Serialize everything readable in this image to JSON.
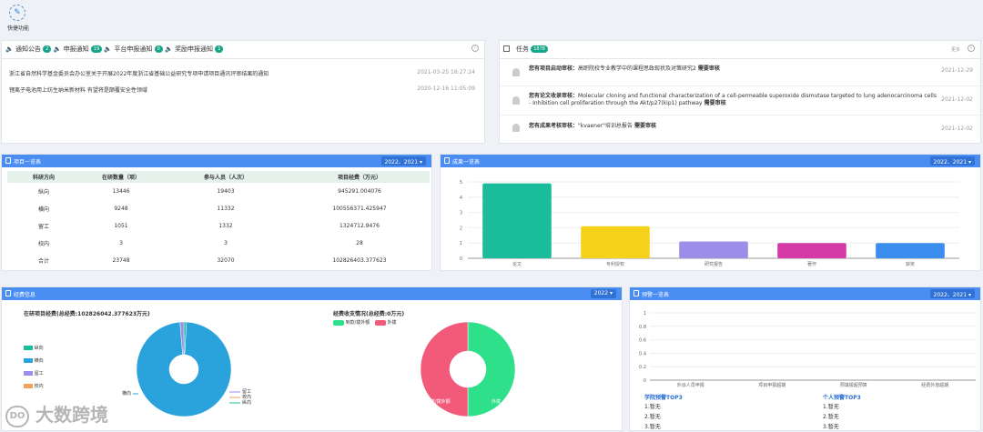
{
  "shortcut": {
    "label": "快捷功能"
  },
  "notices": {
    "tabs": [
      {
        "label": "通知公告",
        "count": "2"
      },
      {
        "label": "申报通知",
        "count": "19"
      },
      {
        "label": "平台申报通知",
        "count": "0"
      },
      {
        "label": "奖励申报通知",
        "count": "1"
      }
    ],
    "items": [
      {
        "title": "浙江省自然科学基金委员会办公室关于开展2022年度浙江省基础公益研究专项申请项目通讯评审结果的通知",
        "date": "2021-03-25 16:27:24"
      },
      {
        "title": "锂离子电池用上纺生纳米新材料 有望将是颠覆安全性领域",
        "date": "2020-12-16 11:05:09"
      }
    ]
  },
  "tasks": {
    "title": "任务",
    "count": "1878",
    "more": "更多",
    "items": [
      {
        "tag": "您有项目启动审核：",
        "text": "高职院校专业教学中的课程思政现状及对策研究2",
        "suffix": " 需要审核",
        "date": "2021-12-29"
      },
      {
        "tag": "您有论文收录审核：",
        "text": "Molecular cloning and functional characterization of a cell-permeable superoxide dismutase targeted to lung adenocarcinoma cells - Inhibition cell proliferation through the Akt/p27(kip1) pathway",
        "suffix": " 需要审核",
        "date": "2021-12-02"
      },
      {
        "tag": "您有成果考核审核：",
        "text": "\"kvaener\"培训总报告",
        "suffix": " 需要审核",
        "date": "2021-12-02"
      }
    ]
  },
  "projects": {
    "title": "项目一览表",
    "year": "2022、2021",
    "headers": [
      "科研方向",
      "在研数量（项）",
      "参与人员（人次）",
      "项目经费（万元）"
    ],
    "rows": [
      [
        "纵向",
        "13446",
        "19403",
        "945291.004076"
      ],
      [
        "横向",
        "9248",
        "11332",
        "100556371.425947"
      ],
      [
        "留工",
        "1051",
        "1332",
        "1324712.9476"
      ],
      [
        "校内",
        "3",
        "3",
        "28"
      ],
      [
        "合计",
        "23748",
        "32070",
        "102826403.377623"
      ]
    ]
  },
  "achievements": {
    "title": "成果一览表",
    "year": "2022、2021"
  },
  "funding": {
    "title": "经费信息",
    "year": "2022",
    "left_title": "在研项目经费(总经费:102826042.377623万元)",
    "right_title": "经费收支情况(总经费:0万元)",
    "left_legend": [
      "纵向",
      "横向",
      "留工",
      "校内"
    ],
    "right_legend": [
      "到款/拨外额",
      "外拨"
    ],
    "pie_labels": [
      "横向",
      "留工",
      "校内",
      "纵向"
    ]
  },
  "warnings": {
    "title": "预警一览表",
    "year": "2022、2021",
    "college_title": "学院预警TOP3",
    "person_title": "个人预警TOP3",
    "college_items": [
      "1.暂无",
      "2.暂无",
      "3.暂无"
    ],
    "person_items": [
      "1.暂无",
      "2.暂无",
      "3.暂无"
    ]
  },
  "watermark": "大数跨境",
  "chart_data": [
    {
      "type": "bar",
      "categories": [
        "论文",
        "专利授权",
        "研究报告",
        "著作",
        "获奖"
      ],
      "values": [
        4.9,
        2.1,
        1.1,
        1.0,
        1.0
      ],
      "colors": [
        "#1abc9c",
        "#f7d21a",
        "#9b8de8",
        "#d63aa6",
        "#3b8df0"
      ],
      "ylim": [
        0,
        5
      ],
      "yticks": [
        "0",
        "1",
        "2",
        "3",
        "4",
        "5"
      ]
    },
    {
      "type": "bar",
      "categories": [
        "外派人员申报",
        "项目申报超期",
        "预填报超预算",
        "经费外放超期"
      ],
      "values": [
        0,
        0,
        0,
        0
      ],
      "ylim": [
        0,
        1
      ],
      "yticks": [
        "0",
        "0.2",
        "0.4",
        "0.6",
        "0.8",
        "1"
      ]
    },
    {
      "type": "pie",
      "categories": [
        "纵向",
        "横向",
        "留工",
        "校内"
      ],
      "values": [
        0.9,
        97.8,
        1.3,
        0.0
      ],
      "colors": [
        "#1abc9c",
        "#2aa3dc",
        "#9b8de8",
        "#f0a35e"
      ]
    },
    {
      "type": "pie",
      "categories": [
        "到款/拨外额",
        "外拨"
      ],
      "values": [
        50,
        50
      ],
      "colors": [
        "#2fe08a",
        "#f25a7a"
      ]
    }
  ]
}
